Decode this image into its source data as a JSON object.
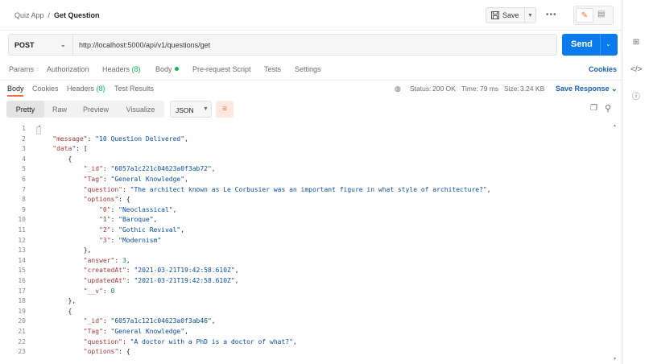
{
  "header": {
    "collection": "Quiz App",
    "separator": "/",
    "request_name": "Get Question",
    "save_label": "Save",
    "more_icon": "more-icon"
  },
  "request": {
    "method": "POST",
    "url": "http://localhost:5000/api/v1/questions/get",
    "send_label": "Send"
  },
  "request_tabs": [
    {
      "label": "Params"
    },
    {
      "label": "Authorization"
    },
    {
      "label": "Headers",
      "count": "(8)"
    },
    {
      "label": "Body"
    },
    {
      "label": "Pre-request Script"
    },
    {
      "label": "Tests"
    },
    {
      "label": "Settings"
    }
  ],
  "cookies_link": "Cookies",
  "response_tabs": [
    {
      "label": "Body"
    },
    {
      "label": "Cookies"
    },
    {
      "label": "Headers",
      "count": "(8)"
    },
    {
      "label": "Test Results"
    }
  ],
  "response_stats": {
    "status_label": "Status:",
    "status_value": "200 OK",
    "time_label": "Time:",
    "time_value": "79 ms",
    "size_label": "Size:",
    "size_value": "3.24 KB",
    "save_response": "Save Response"
  },
  "view_modes": [
    "Pretty",
    "Raw",
    "Preview",
    "Visualize"
  ],
  "format": "JSON",
  "colors": {
    "accent": "#ff6c37",
    "send": "#097bed",
    "success": "#0cbb52",
    "link": "#1a5ebd"
  },
  "code_lines": [
    {
      "n": "1",
      "t": "{"
    },
    {
      "n": "2",
      "t": "    \"message\": \"10 Question Delivered\","
    },
    {
      "n": "3",
      "t": "    \"data\": ["
    },
    {
      "n": "4",
      "t": "        {"
    },
    {
      "n": "5",
      "t": "            \"_id\": \"6057a1c221c04623a0f3ab72\","
    },
    {
      "n": "6",
      "t": "            \"Tag\": \"General Knowledge\","
    },
    {
      "n": "7",
      "t": "            \"question\": \"The architect known as Le Corbusier was an important figure in what style of architecture?\","
    },
    {
      "n": "8",
      "t": "            \"options\": {"
    },
    {
      "n": "9",
      "t": "                \"0\": \"Neoclassical\","
    },
    {
      "n": "10",
      "t": "                \"1\": \"Baroque\","
    },
    {
      "n": "11",
      "t": "                \"2\": \"Gothic Revival\","
    },
    {
      "n": "12",
      "t": "                \"3\": \"Modernism\""
    },
    {
      "n": "13",
      "t": "            },"
    },
    {
      "n": "14",
      "t": "            \"answer\": 3,"
    },
    {
      "n": "15",
      "t": "            \"createdAt\": \"2021-03-21T19:42:58.610Z\","
    },
    {
      "n": "16",
      "t": "            \"updatedAt\": \"2021-03-21T19:42:58.610Z\","
    },
    {
      "n": "17",
      "t": "            \"__v\": 0"
    },
    {
      "n": "18",
      "t": "        },"
    },
    {
      "n": "19",
      "t": "        {"
    },
    {
      "n": "20",
      "t": "            \"_id\": \"6057a1c121c04623a0f3ab46\","
    },
    {
      "n": "21",
      "t": "            \"Tag\": \"General Knowledge\","
    },
    {
      "n": "22",
      "t": "            \"question\": \"A doctor with a PhD is a doctor of what?\","
    },
    {
      "n": "23",
      "t": "            \"options\": {"
    }
  ]
}
